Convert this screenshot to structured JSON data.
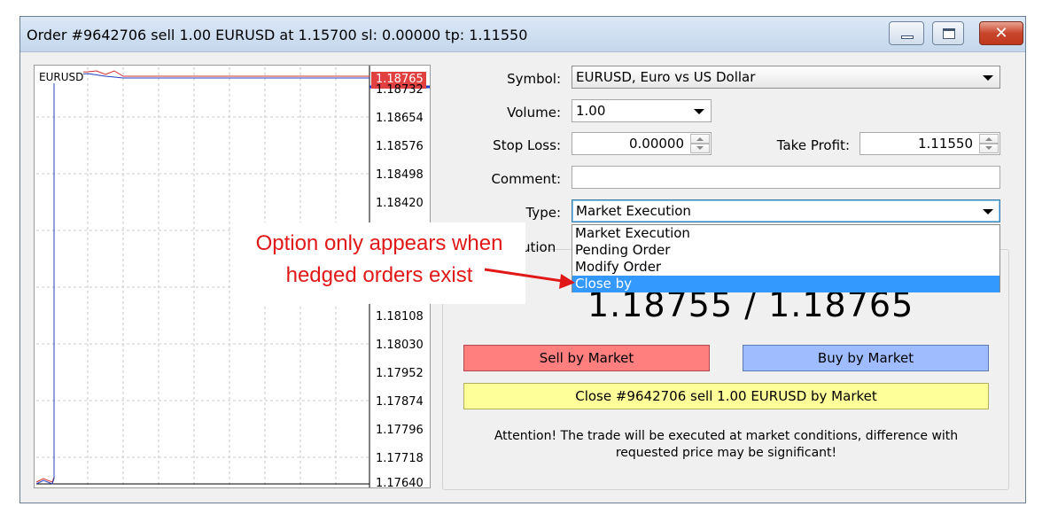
{
  "window": {
    "title": "Order #9642706 sell 1.00 EURUSD at 1.15700 sl: 0.00000 tp: 1.11550",
    "close_glyph": "✕"
  },
  "chart": {
    "symbol": "EURUSD",
    "current_price": "1.18765",
    "price_labels": [
      "1.18732",
      "1.18654",
      "1.18576",
      "1.18498",
      "1.18420",
      "1.18108",
      "1.18030",
      "1.17952",
      "1.17874",
      "1.17796",
      "1.17718",
      "1.17640"
    ]
  },
  "form": {
    "symbol_label": "Symbol:",
    "symbol_value": "EURUSD, Euro vs US Dollar",
    "volume_label": "Volume:",
    "volume_value": "1.00",
    "stoploss_label": "Stop Loss:",
    "stoploss_value": "0.00000",
    "takeprofit_label": "Take Profit:",
    "takeprofit_value": "1.11550",
    "comment_label": "Comment:",
    "comment_value": "",
    "type_label": "Type:",
    "type_value": "Market Execution",
    "execution_partial": "ution"
  },
  "dropdown": {
    "options": [
      "Market Execution",
      "Pending Order",
      "Modify Order",
      "Close by"
    ],
    "selected_index": 3
  },
  "quote": "1.18755 / 1.18765",
  "buttons": {
    "sell": "Sell by Market",
    "buy": "Buy by Market",
    "close": "Close #9642706 sell 1.00 EURUSD by Market"
  },
  "attention": {
    "line1": "Attention! The trade will be executed at market conditions, difference with",
    "line2": "requested price may be significant!"
  },
  "annotation": {
    "line1": "Option only appears when",
    "line2": "hedged orders exist",
    "color": "#e01818"
  }
}
